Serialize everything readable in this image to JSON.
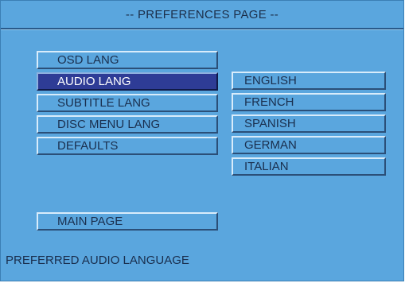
{
  "header": {
    "title": "-- PREFERENCES PAGE --"
  },
  "menu": {
    "items": [
      {
        "label": "OSD LANG"
      },
      {
        "label": "AUDIO LANG"
      },
      {
        "label": "SUBTITLE LANG"
      },
      {
        "label": "DISC MENU LANG"
      },
      {
        "label": "DEFAULTS"
      }
    ],
    "selected_label": "AUDIO LANG"
  },
  "submenu": {
    "options": [
      {
        "label": "ENGLISH"
      },
      {
        "label": "FRENCH"
      },
      {
        "label": "SPANISH"
      },
      {
        "label": "GERMAN"
      },
      {
        "label": "ITALIAN"
      }
    ]
  },
  "footer": {
    "main_page_label": "MAIN PAGE",
    "status_text": "PREFERRED AUDIO LANGUAGE"
  },
  "colors": {
    "background": "#5aa6de",
    "selected": "#2e3c96",
    "text": "#1a2f4e",
    "selected_text": "#ffffff"
  }
}
